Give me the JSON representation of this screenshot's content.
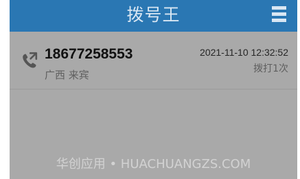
{
  "header": {
    "title": "拨号王",
    "menu_icon": "hamburger-menu-icon"
  },
  "call_log": [
    {
      "icon": "phone-call-icon",
      "number": "18677258553",
      "location": "广西 来宾",
      "datetime": "2021-11-10 12:32:52",
      "count_label": "拨打1次"
    }
  ],
  "watermark": "华创应用 • HUACHUANGZS.COM",
  "colors": {
    "header_bg": "#2a77b3",
    "list_bg": "#a9a9a9",
    "header_text": "#d9e7f3"
  }
}
